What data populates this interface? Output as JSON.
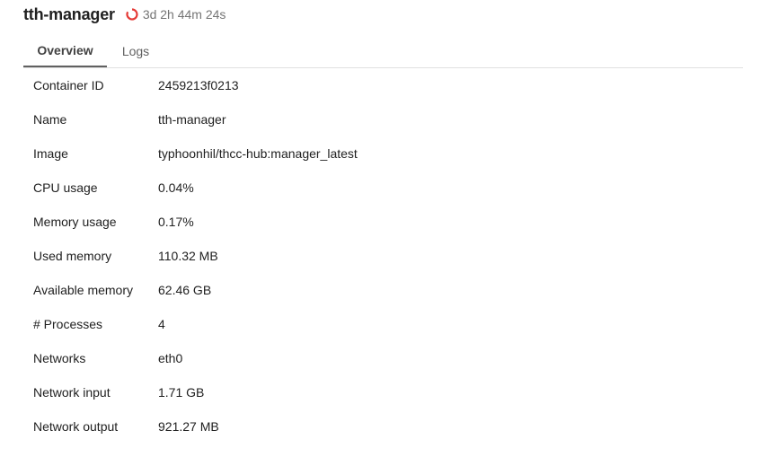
{
  "header": {
    "title": "tth-manager",
    "status_icon": "running-spinner-icon",
    "status_color": "#e53935",
    "uptime": "3d 2h 44m 24s"
  },
  "tabs": [
    {
      "label": "Overview",
      "active": true
    },
    {
      "label": "Logs",
      "active": false
    }
  ],
  "details": [
    {
      "label": "Container ID",
      "value": "2459213f0213"
    },
    {
      "label": "Name",
      "value": "tth-manager"
    },
    {
      "label": "Image",
      "value": "typhoonhil/thcc-hub:manager_latest"
    },
    {
      "label": "CPU usage",
      "value": "0.04%"
    },
    {
      "label": "Memory usage",
      "value": "0.17%"
    },
    {
      "label": "Used memory",
      "value": "110.32 MB"
    },
    {
      "label": "Available memory",
      "value": "62.46 GB"
    },
    {
      "label": "# Processes",
      "value": "4"
    },
    {
      "label": "Networks",
      "value": "eth0"
    },
    {
      "label": "Network input",
      "value": "1.71 GB"
    },
    {
      "label": "Network output",
      "value": "921.27 MB"
    }
  ]
}
